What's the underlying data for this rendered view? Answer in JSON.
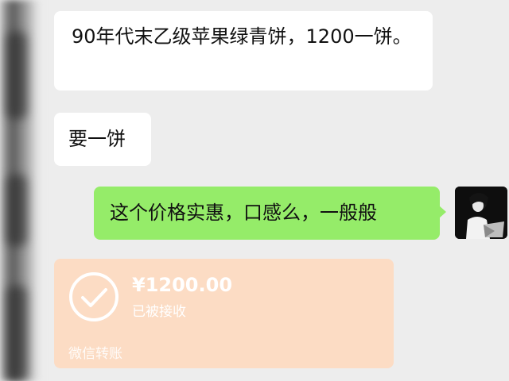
{
  "messages": [
    {
      "from": "other",
      "text": "90年代末乙级苹果绿青饼，1200一饼。"
    },
    {
      "from": "other",
      "text": "要一饼"
    },
    {
      "from": "self",
      "text": "这个价格实惠，口感么，一般般"
    }
  ],
  "transfer": {
    "amount": "¥1200.00",
    "status": "已被接收",
    "label": "微信转账",
    "icon": "check-circle-icon",
    "bg_color": "#fcdcc4"
  },
  "self_avatar": {
    "icon": "avatar-photo"
  },
  "colors": {
    "background": "#ededed",
    "self_bubble": "#95ec69",
    "other_bubble": "#ffffff"
  }
}
